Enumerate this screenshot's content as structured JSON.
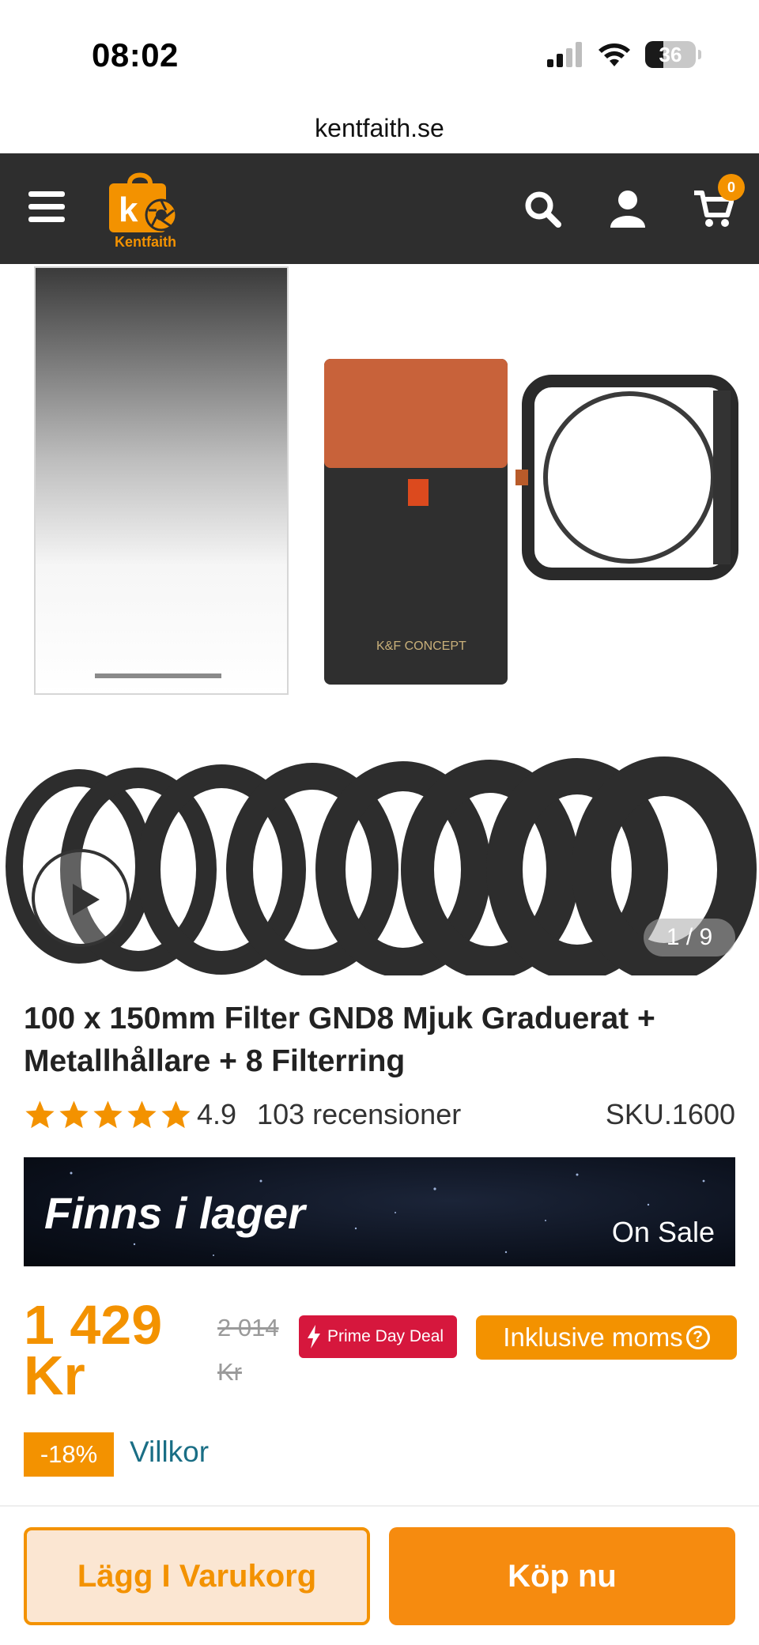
{
  "status_bar": {
    "time": "08:02",
    "battery": "36",
    "icons": [
      "signal-icon",
      "wifi-icon",
      "battery-icon"
    ]
  },
  "browser": {
    "url": "kentfaith.se"
  },
  "header": {
    "logo_text": "Kentfaith",
    "cart_count": "0",
    "icons": [
      "menu-icon",
      "search-icon",
      "user-icon",
      "cart-icon"
    ],
    "colors": {
      "background": "#2e2e2e",
      "accent": "#f39200"
    }
  },
  "gallery": {
    "counter": "1 / 9"
  },
  "product": {
    "title": "100 x 150mm Filter GND8 Mjuk Graduerat + Metallhållare + 8 Filterring",
    "rating": "4.9",
    "rating_value": 4.9,
    "reviews": "103 recensioner",
    "sku": "SKU.1600",
    "stock_banner": {
      "title": "Finns i lager",
      "tag": "On Sale"
    },
    "price": {
      "current_amount": "1 429",
      "current_unit": "Kr",
      "old_amount": "2 014",
      "old_unit": "Kr"
    },
    "prime_badge": "Prime Day Deal",
    "vat_label": "Inklusive moms",
    "discount": "-18%",
    "terms": "Villkor"
  },
  "actions": {
    "add_to_cart": "Lägg I Varukorg",
    "buy_now": "Köp nu"
  },
  "colors": {
    "accent": "#f39200",
    "prime": "#d6173d",
    "link": "#1a6e85"
  }
}
